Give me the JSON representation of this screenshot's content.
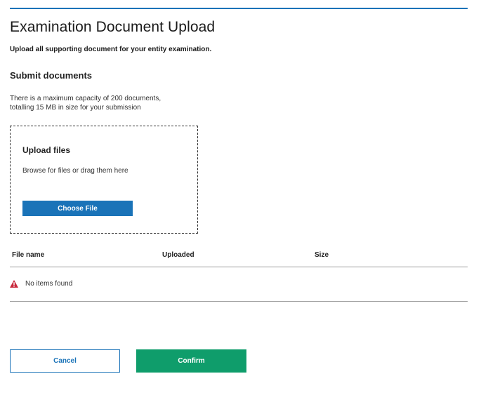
{
  "page": {
    "title": "Examination Document Upload",
    "intro": "Upload all supporting document for your entity examination."
  },
  "submit": {
    "title": "Submit documents",
    "capacity_line1": "There is a maximum capacity of 200 documents,",
    "capacity_line2": "totalling 15 MB in size for your submission"
  },
  "upload": {
    "title": "Upload files",
    "hint": "Browse for files or drag them here",
    "choose_label": "Choose File"
  },
  "table": {
    "columns": [
      "File name",
      "Uploaded",
      "Size"
    ],
    "empty_message": "No items found",
    "empty_icon": "warning-icon"
  },
  "actions": {
    "cancel_label": "Cancel",
    "confirm_label": "Confirm"
  },
  "colors": {
    "accent": "#1a73b8",
    "confirm": "#0f9d6b",
    "warning": "#c8283c"
  }
}
